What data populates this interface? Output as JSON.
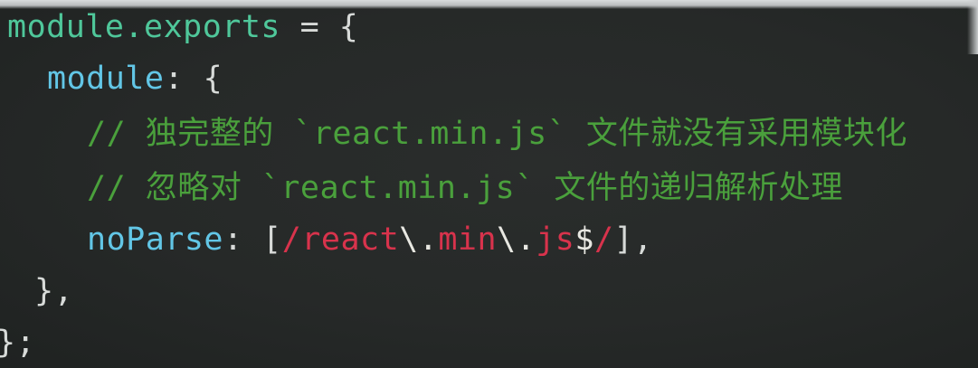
{
  "code": {
    "line1": {
      "ident": "module.exports",
      "rest": " = {"
    },
    "line2": {
      "prop": "module",
      "rest": ": {"
    },
    "line3": {
      "comment": "// 独完整的 `react.min.js` 文件就没有采用模块化"
    },
    "line4": {
      "comment": "// 忽略对 `react.min.js` 文件的递归解析处理"
    },
    "line5": {
      "prop": "noParse",
      "colon": ": [",
      "regex_open": "/react",
      "esc1": "\\.",
      "regex_mid": "min",
      "esc2": "\\.",
      "regex_js": "js",
      "dollar": "$",
      "regex_close": "/",
      "rest": "],"
    },
    "line6": {
      "text": "},"
    },
    "line7": {
      "text": "};"
    }
  },
  "colors": {
    "background": "#262928",
    "identifier": "#4fc79a",
    "property": "#62c6e6",
    "comment": "#4aa03c",
    "regex": "#d8334c",
    "punctuation": "#d7dad8"
  }
}
